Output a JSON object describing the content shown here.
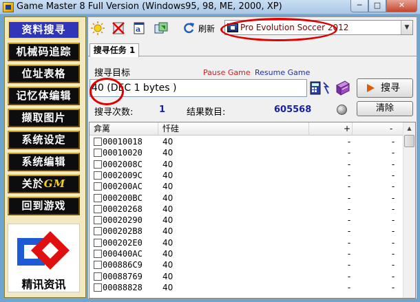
{
  "window": {
    "title": "Game Master 8 Full Version (Windows95, 98, ME, 2000, XP)",
    "minimize": "─",
    "maximize": "□",
    "close": "✕"
  },
  "sidebar": {
    "items": [
      {
        "label": "资料搜寻"
      },
      {
        "label": "机械码追踪"
      },
      {
        "label": "位址表格"
      },
      {
        "label": "记忆体编辑"
      },
      {
        "label": "撷取图片"
      },
      {
        "label": "系统设定"
      },
      {
        "label": "系统编辑"
      },
      {
        "label": "关於",
        "suffix": "GM"
      },
      {
        "label": "回到游戏"
      }
    ],
    "logo_text": "精讯资讯"
  },
  "toolbar": {
    "refresh_label": "刷新",
    "process_name": "Pro Evolution Soccer 2012",
    "icons": [
      "sun-icon",
      "no-entry-icon",
      "notepad-icon",
      "process-icon",
      "refresh-icon"
    ]
  },
  "tabs": [
    {
      "label": "搜寻任务 1"
    }
  ],
  "search": {
    "target_label": "搜寻目标",
    "pause_label": "Pause Game",
    "resume_label": "Resume Game",
    "target_value": "40 (DEC 1 bytes )",
    "search_button": "搜寻",
    "search_count_label": "搜寻次数:",
    "search_count": "1",
    "result_count_label": "结果数目:",
    "result_count": "605568",
    "clear_button": "清除"
  },
  "results": {
    "columns": [
      "弇蓠",
      "忏硅",
      "+",
      "-"
    ],
    "rows": [
      {
        "address": "00010018",
        "value": "40",
        "c3": "-",
        "c4": "-"
      },
      {
        "address": "00010020",
        "value": "40",
        "c3": "-",
        "c4": "-"
      },
      {
        "address": "0002008C",
        "value": "40",
        "c3": "-",
        "c4": "-"
      },
      {
        "address": "0002009C",
        "value": "40",
        "c3": "-",
        "c4": "-"
      },
      {
        "address": "000200AC",
        "value": "40",
        "c3": "-",
        "c4": "-"
      },
      {
        "address": "000200BC",
        "value": "40",
        "c3": "-",
        "c4": "-"
      },
      {
        "address": "00020268",
        "value": "40",
        "c3": "-",
        "c4": "-"
      },
      {
        "address": "00020290",
        "value": "40",
        "c3": "-",
        "c4": "-"
      },
      {
        "address": "000202B8",
        "value": "40",
        "c3": "-",
        "c4": "-"
      },
      {
        "address": "000202E0",
        "value": "40",
        "c3": "-",
        "c4": "-"
      },
      {
        "address": "000400AC",
        "value": "40",
        "c3": "-",
        "c4": "-"
      },
      {
        "address": "000886C9",
        "value": "40",
        "c3": "-",
        "c4": "-"
      },
      {
        "address": "00088769",
        "value": "40",
        "c3": "-",
        "c4": "-"
      },
      {
        "address": "00088828",
        "value": "40",
        "c3": "-",
        "c4": "-"
      }
    ]
  },
  "colors": {
    "annotation": "#e00000",
    "count_blue": "#1520a6",
    "pause_red": "#cc1f1f",
    "resume_blue": "#1b2ea8",
    "sidebar_active": "#2f36b8"
  }
}
